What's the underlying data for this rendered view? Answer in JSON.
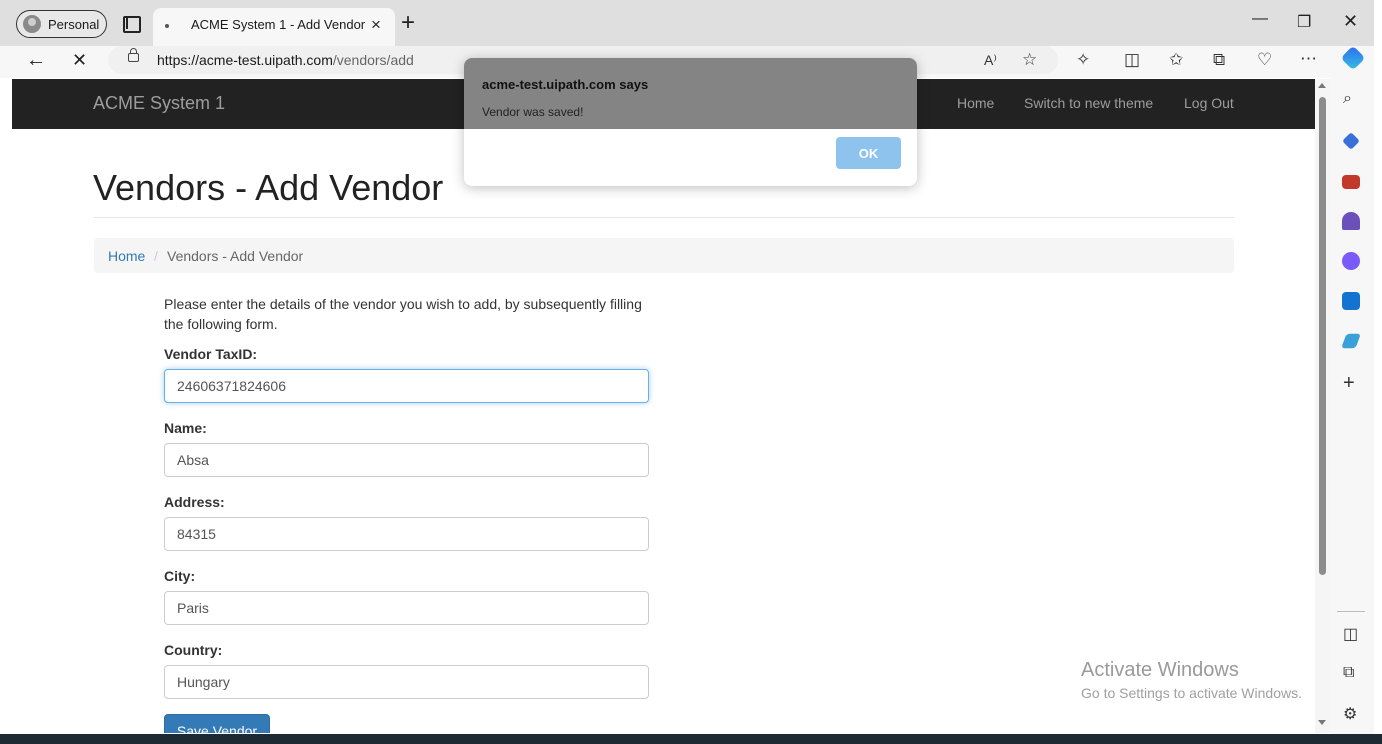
{
  "browser": {
    "profile_label": "Personal",
    "tab_title": "ACME System 1 - Add Vendor",
    "tab_close_glyph": "×",
    "new_tab_glyph": "+",
    "url_host": "https://acme-test.uipath.com",
    "url_path": "/vendors/add",
    "icons": [
      "back-icon",
      "stop-loading-icon",
      "read-aloud-icon",
      "favorite-icon",
      "extensions-icon",
      "split-screen-icon",
      "favorites-icon",
      "collections-icon",
      "browser-essentials-icon",
      "more-icon",
      "copilot-icon"
    ]
  },
  "app": {
    "brand": "ACME System 1",
    "nav": {
      "home": "Home",
      "switch_theme": "Switch to new theme",
      "logout": "Log Out"
    }
  },
  "page": {
    "title": "Vendors - Add Vendor",
    "breadcrumb": {
      "home": "Home",
      "separator": "/",
      "current": "Vendors - Add Vendor"
    },
    "intro": "Please enter the details of the vendor you wish to add, by subsequently filling the following form.",
    "fields": {
      "taxid": {
        "label": "Vendor TaxID:",
        "value": "24606371824606"
      },
      "name": {
        "label": "Name:",
        "value": "Absa"
      },
      "address": {
        "label": "Address:",
        "value": "84315"
      },
      "city": {
        "label": "City:",
        "value": "Paris"
      },
      "country": {
        "label": "Country:",
        "value": "Hungary"
      }
    },
    "save_button": "Save Vendor"
  },
  "dialog": {
    "title": "acme-test.uipath.com says",
    "message": "Vendor was saved!",
    "ok": "OK"
  },
  "watermark": {
    "title": "Activate Windows",
    "subtitle": "Go to Settings to activate Windows."
  },
  "sidebar": {
    "icons": [
      "search-icon",
      "shopping-tag-icon",
      "tools-icon",
      "games-icon",
      "microsoft-365-icon",
      "outlook-icon",
      "telegram-icon",
      "add-icon",
      "sidebar-toggle-icon",
      "external-open-icon",
      "settings-icon"
    ]
  },
  "colors": {
    "navbar": "#222222",
    "link": "#337ab7",
    "primary_button": "#337ab7",
    "dialog_ok": "#8ec3ee"
  }
}
